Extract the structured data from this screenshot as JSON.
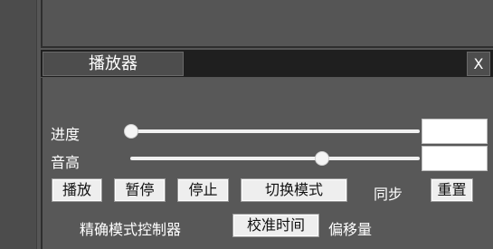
{
  "window": {
    "title": "播放器",
    "close_label": "X"
  },
  "controls": {
    "progress_label": "进度",
    "volume_label": "音高",
    "progress_value": 0.0,
    "volume_value": 0.66,
    "progress_box_value": "",
    "volume_box_value": ""
  },
  "buttons": {
    "play": "播放",
    "pause": "暂停",
    "stop": "停止",
    "switch_mode": "切换模式",
    "sync_label": "同步",
    "reset": "重置"
  },
  "precise": {
    "label": "精确模式控制器",
    "calibrate_time": "校准时间",
    "offset_label": "偏移量"
  }
}
